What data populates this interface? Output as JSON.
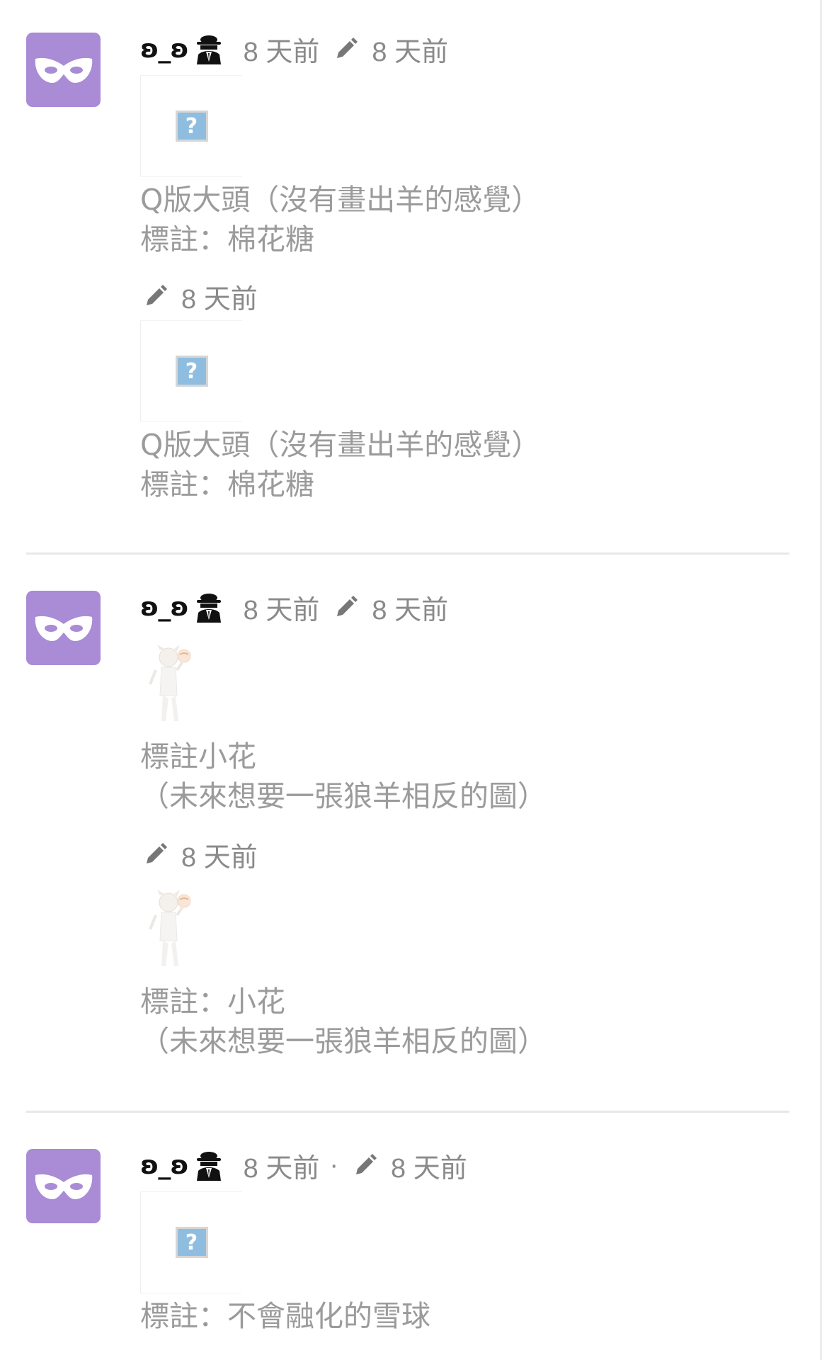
{
  "colors": {
    "avatar": "#a98bd6",
    "username": "#111111",
    "meta_text": "#8a8a8a",
    "body_text": "#9b9b9b",
    "divider": "#e8e8e8"
  },
  "icons": {
    "avatar": "mask-icon",
    "badge": "spy-icon",
    "edit": "pencil-icon",
    "broken_image": "broken-image-icon"
  },
  "posts": [
    {
      "username": "ʚ_ʚ",
      "time": "8 天前",
      "separator": "",
      "edit_time": "8 天前",
      "content_thumb": "broken-image",
      "content_lines": [
        "Q版大頭（沒有畫出羊的感覺）",
        "標註：棉花糖"
      ],
      "revision": {
        "edit_time": "8 天前",
        "thumb": "broken-image",
        "lines": [
          "Q版大頭（沒有畫出羊的感覺）",
          "標註：棉花糖"
        ]
      }
    },
    {
      "username": "ʚ_ʚ",
      "time": "8 天前",
      "separator": "",
      "edit_time": "8 天前",
      "content_thumb": "character-sketch",
      "content_lines": [
        "標註小花",
        "（未來想要一張狼羊相反的圖）"
      ],
      "revision": {
        "edit_time": "8 天前",
        "thumb": "character-sketch",
        "lines": [
          "標註：小花",
          "（未來想要一張狼羊相反的圖）"
        ]
      }
    },
    {
      "username": "ʚ_ʚ",
      "time": "8 天前",
      "separator": "·",
      "edit_time": "8 天前",
      "content_thumb": "broken-image",
      "content_lines": [
        "標註：不會融化的雪球"
      ]
    }
  ]
}
